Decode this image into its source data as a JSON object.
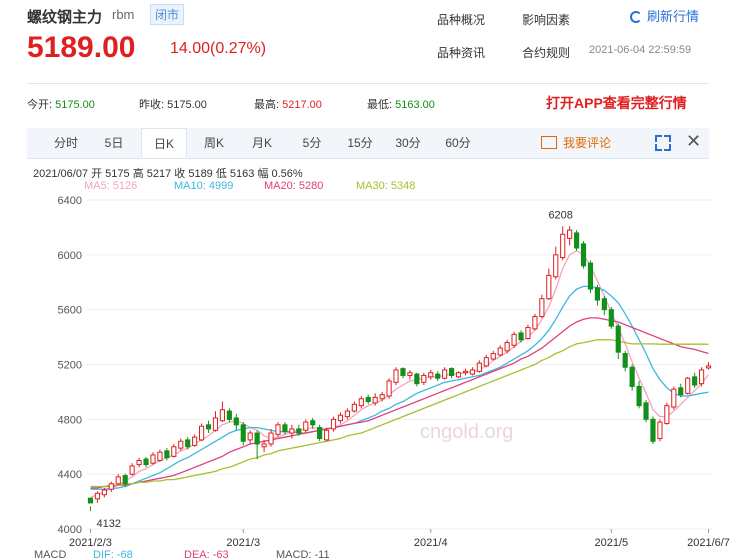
{
  "header": {
    "name": "螺纹钢主力",
    "code": "rbm",
    "status": "闭市",
    "price": "5189.00",
    "change": "14.00(0.27%)"
  },
  "links": [
    "品种概况",
    "影响因素",
    "品种资讯",
    "合约规则"
  ],
  "refresh": "刷新行情",
  "time": "2021-06-04 22:59:59",
  "stats": {
    "open_label": "今开:",
    "open": "5175.00",
    "prev_label": "昨收:",
    "prev": "5175.00",
    "high_label": "最高:",
    "high": "5217.00",
    "low_label": "最低:",
    "low": "5163.00"
  },
  "app_cta": "打开APP查看完整行情",
  "tabs": [
    "分时",
    "5日",
    "日K",
    "周K",
    "月K",
    "5分",
    "15分",
    "30分",
    "60分"
  ],
  "active_tab": "日K",
  "comment": "我要评论",
  "info": "2021/06/07 开 5175 高 5217 收 5189 低 5163 幅 0.56%",
  "ma": [
    {
      "label": "MA5: 5126",
      "color": "#f5a3c2"
    },
    {
      "label": "MA10: 4999",
      "color": "#3cb8e0"
    },
    {
      "label": "MA20: 5280",
      "color": "#e0407a"
    },
    {
      "label": "MA30: 5348",
      "color": "#a8be2e"
    }
  ],
  "macd": [
    {
      "label": "MACD",
      "color": "#555"
    },
    {
      "label": "DIF: -68",
      "color": "#3cb8e0"
    },
    {
      "label": "DEA: -63",
      "color": "#e0407a"
    },
    {
      "label": "MACD: -11",
      "color": "#555"
    }
  ],
  "watermark": "cngold.org",
  "chart_data": {
    "type": "candlestick",
    "ylim": [
      4000,
      6400
    ],
    "yticks": [
      6400,
      6000,
      5600,
      5200,
      4800,
      4400,
      4000
    ],
    "xtick_labels": [
      "2021/2/3",
      "2021/3",
      "2021/4",
      "2021/5",
      "2021/6/7"
    ],
    "annotations": [
      {
        "text": "6208",
        "value": 6208
      },
      {
        "text": "4132",
        "value": 4132
      }
    ],
    "candles": [
      [
        4190,
        4225,
        4165,
        4132
      ],
      [
        4260,
        4220,
        4275,
        4190
      ],
      [
        4285,
        4250,
        4300,
        4230
      ],
      [
        4330,
        4290,
        4345,
        4270
      ],
      [
        4380,
        4330,
        4400,
        4320
      ],
      [
        4330,
        4390,
        4405,
        4310
      ],
      [
        4460,
        4400,
        4480,
        4390
      ],
      [
        4500,
        4470,
        4520,
        4450
      ],
      [
        4470,
        4510,
        4525,
        4450
      ],
      [
        4540,
        4480,
        4560,
        4470
      ],
      [
        4560,
        4500,
        4580,
        4490
      ],
      [
        4520,
        4570,
        4590,
        4500
      ],
      [
        4600,
        4530,
        4620,
        4520
      ],
      [
        4640,
        4590,
        4660,
        4570
      ],
      [
        4600,
        4650,
        4670,
        4580
      ],
      [
        4670,
        4610,
        4690,
        4600
      ],
      [
        4750,
        4650,
        4770,
        4640
      ],
      [
        4730,
        4760,
        4790,
        4700
      ],
      [
        4810,
        4720,
        4860,
        4710
      ],
      [
        4870,
        4790,
        4930,
        4780
      ],
      [
        4800,
        4860,
        4880,
        4780
      ],
      [
        4760,
        4810,
        4840,
        4720
      ],
      [
        4640,
        4760,
        4780,
        4610
      ],
      [
        4700,
        4650,
        4720,
        4620
      ],
      [
        4620,
        4700,
        4720,
        4510
      ],
      [
        4620,
        4600,
        4650,
        4560
      ],
      [
        4700,
        4620,
        4730,
        4600
      ],
      [
        4760,
        4690,
        4780,
        4670
      ],
      [
        4710,
        4760,
        4780,
        4690
      ],
      [
        4730,
        4700,
        4760,
        4660
      ],
      [
        4700,
        4730,
        4760,
        4680
      ],
      [
        4780,
        4720,
        4800,
        4700
      ],
      [
        4760,
        4790,
        4810,
        4730
      ],
      [
        4660,
        4740,
        4760,
        4640
      ],
      [
        4720,
        4650,
        4740,
        4640
      ],
      [
        4800,
        4730,
        4820,
        4710
      ],
      [
        4830,
        4790,
        4850,
        4770
      ],
      [
        4860,
        4820,
        4880,
        4800
      ],
      [
        4910,
        4860,
        4930,
        4850
      ],
      [
        4950,
        4900,
        4970,
        4880
      ],
      [
        4930,
        4960,
        4980,
        4910
      ],
      [
        4960,
        4920,
        4990,
        4900
      ],
      [
        4980,
        4950,
        5000,
        4930
      ],
      [
        5080,
        4970,
        5100,
        4950
      ],
      [
        5160,
        5070,
        5180,
        5050
      ],
      [
        5120,
        5170,
        5180,
        5100
      ],
      [
        5140,
        5120,
        5160,
        5090
      ],
      [
        5060,
        5130,
        5140,
        5040
      ],
      [
        5120,
        5070,
        5140,
        5050
      ],
      [
        5140,
        5110,
        5160,
        5090
      ],
      [
        5100,
        5130,
        5150,
        5080
      ],
      [
        5160,
        5100,
        5180,
        5090
      ],
      [
        5120,
        5170,
        5180,
        5100
      ],
      [
        5140,
        5110,
        5150,
        5100
      ],
      [
        5150,
        5140,
        5170,
        5120
      ],
      [
        5160,
        5130,
        5180,
        5120
      ],
      [
        5210,
        5150,
        5230,
        5140
      ],
      [
        5250,
        5190,
        5270,
        5180
      ],
      [
        5280,
        5240,
        5300,
        5230
      ],
      [
        5320,
        5270,
        5340,
        5260
      ],
      [
        5360,
        5300,
        5380,
        5280
      ],
      [
        5420,
        5340,
        5440,
        5320
      ],
      [
        5380,
        5430,
        5450,
        5360
      ],
      [
        5470,
        5390,
        5490,
        5380
      ],
      [
        5550,
        5460,
        5570,
        5450
      ],
      [
        5680,
        5550,
        5710,
        5540
      ],
      [
        5850,
        5680,
        5900,
        5670
      ],
      [
        6000,
        5840,
        6060,
        5820
      ],
      [
        6150,
        5980,
        6208,
        5960
      ],
      [
        6180,
        6120,
        6208,
        6070
      ],
      [
        6050,
        6160,
        6180,
        6030
      ],
      [
        5920,
        6080,
        6100,
        5900
      ],
      [
        5750,
        5940,
        5960,
        5720
      ],
      [
        5670,
        5760,
        5780,
        5630
      ],
      [
        5600,
        5680,
        5700,
        5560
      ],
      [
        5480,
        5600,
        5620,
        5460
      ],
      [
        5290,
        5480,
        5500,
        5240
      ],
      [
        5180,
        5280,
        5300,
        5150
      ],
      [
        5040,
        5180,
        5200,
        5010
      ],
      [
        4900,
        5040,
        5080,
        4880
      ],
      [
        4800,
        4920,
        4940,
        4780
      ],
      [
        4640,
        4800,
        4820,
        4620
      ],
      [
        4780,
        4660,
        4800,
        4640
      ],
      [
        4900,
        4770,
        4920,
        4760
      ],
      [
        5020,
        4890,
        5040,
        4870
      ],
      [
        4980,
        5030,
        5060,
        4960
      ],
      [
        5100,
        4990,
        5110,
        4980
      ],
      [
        5050,
        5110,
        5140,
        5030
      ],
      [
        5160,
        5060,
        5180,
        5040
      ],
      [
        5189,
        5175,
        5217,
        5163
      ]
    ],
    "series": [
      {
        "name": "MA5",
        "color": "#f5a3c2",
        "values": [
          4230,
          4250,
          4270,
          4300,
          4320,
          4350,
          4380,
          4420,
          4440,
          4470,
          4500,
          4520,
          4540,
          4570,
          4590,
          4620,
          4650,
          4680,
          4720,
          4760,
          4780,
          4790,
          4770,
          4740,
          4720,
          4680,
          4660,
          4670,
          4690,
          4710,
          4720,
          4730,
          4740,
          4730,
          4730,
          4740,
          4760,
          4790,
          4830,
          4870,
          4900,
          4920,
          4940,
          4980,
          5020,
          5050,
          5080,
          5090,
          5100,
          5110,
          5110,
          5120,
          5130,
          5130,
          5140,
          5150,
          5160,
          5190,
          5230,
          5260,
          5290,
          5330,
          5370,
          5400,
          5450,
          5530,
          5620,
          5750,
          5900,
          6000,
          6030,
          6000,
          5920,
          5810,
          5700,
          5580,
          5470,
          5350,
          5220,
          5100,
          4990,
          4870,
          4820,
          4820,
          4860,
          4910,
          4960,
          5010,
          5060,
          5126
        ]
      },
      {
        "name": "MA10",
        "color": "#3cb8e0",
        "values": [
          4290,
          4290,
          4290,
          4295,
          4300,
          4310,
          4330,
          4350,
          4370,
          4390,
          4410,
          4440,
          4470,
          4500,
          4520,
          4550,
          4580,
          4610,
          4640,
          4670,
          4700,
          4720,
          4730,
          4740,
          4740,
          4730,
          4720,
          4710,
          4710,
          4710,
          4700,
          4700,
          4710,
          4720,
          4730,
          4740,
          4750,
          4760,
          4770,
          4790,
          4810,
          4830,
          4860,
          4880,
          4910,
          4930,
          4960,
          4990,
          5010,
          5030,
          5050,
          5070,
          5080,
          5090,
          5100,
          5110,
          5120,
          5140,
          5160,
          5180,
          5210,
          5240,
          5270,
          5300,
          5340,
          5390,
          5450,
          5530,
          5620,
          5700,
          5750,
          5770,
          5770,
          5760,
          5740,
          5700,
          5650,
          5570,
          5480,
          5380,
          5280,
          5170,
          5090,
          5030,
          4990,
          4970,
          4970,
          4980,
          4990,
          4999
        ]
      },
      {
        "name": "MA20",
        "color": "#e0407a",
        "values": [
          4300,
          4300,
          4310,
          4310,
          4320,
          4320,
          4330,
          4340,
          4350,
          4360,
          4370,
          4380,
          4390,
          4410,
          4430,
          4450,
          4470,
          4490,
          4510,
          4530,
          4560,
          4580,
          4600,
          4620,
          4630,
          4640,
          4650,
          4660,
          4670,
          4680,
          4690,
          4700,
          4710,
          4720,
          4730,
          4740,
          4750,
          4760,
          4770,
          4780,
          4790,
          4810,
          4830,
          4850,
          4870,
          4890,
          4910,
          4930,
          4950,
          4970,
          4990,
          5010,
          5030,
          5050,
          5070,
          5090,
          5110,
          5130,
          5150,
          5170,
          5190,
          5210,
          5240,
          5260,
          5290,
          5320,
          5360,
          5400,
          5440,
          5480,
          5510,
          5530,
          5540,
          5540,
          5530,
          5520,
          5510,
          5490,
          5470,
          5450,
          5430,
          5410,
          5390,
          5370,
          5350,
          5330,
          5320,
          5310,
          5295,
          5280
        ]
      },
      {
        "name": "MA30",
        "color": "#a8be2e",
        "values": [
          4310,
          4310,
          4310,
          4320,
          4320,
          4330,
          4330,
          4340,
          4340,
          4350,
          4350,
          4360,
          4360,
          4370,
          4380,
          4390,
          4400,
          4410,
          4420,
          4440,
          4450,
          4470,
          4490,
          4510,
          4520,
          4540,
          4550,
          4570,
          4580,
          4590,
          4600,
          4610,
          4620,
          4630,
          4640,
          4650,
          4660,
          4680,
          4690,
          4700,
          4720,
          4740,
          4760,
          4780,
          4800,
          4820,
          4840,
          4860,
          4880,
          4900,
          4920,
          4940,
          4960,
          4980,
          5000,
          5020,
          5040,
          5060,
          5080,
          5100,
          5120,
          5140,
          5160,
          5180,
          5200,
          5230,
          5250,
          5280,
          5300,
          5330,
          5350,
          5360,
          5370,
          5380,
          5380,
          5380,
          5370,
          5360,
          5350,
          5350,
          5350,
          5350,
          5348,
          5348,
          5348,
          5348,
          5348,
          5348,
          5348,
          5348
        ]
      }
    ]
  }
}
